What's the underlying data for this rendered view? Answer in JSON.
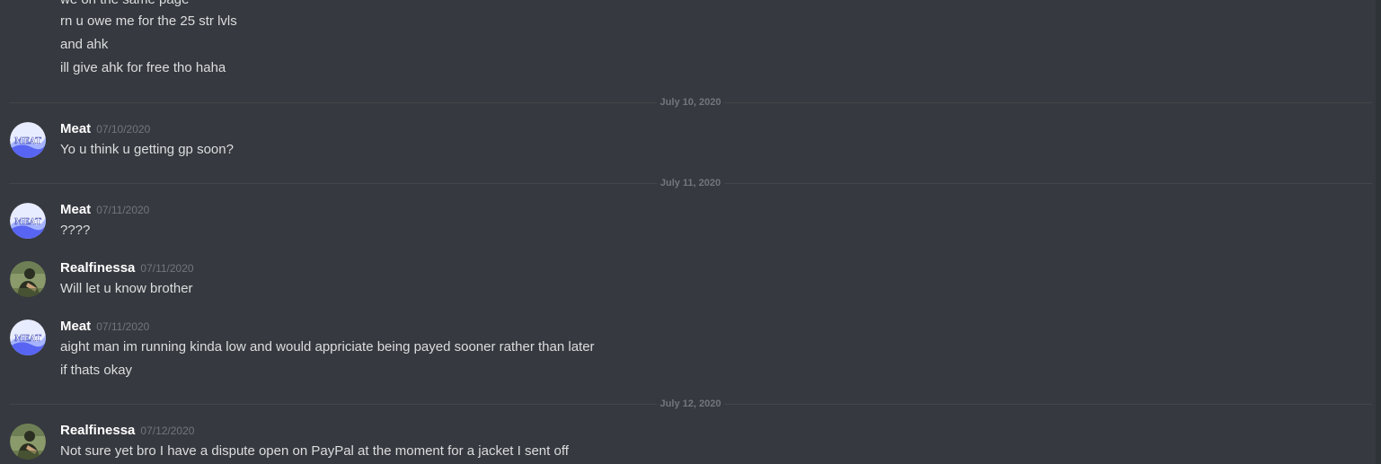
{
  "continuation": [
    "we on the same page",
    "rn u owe me for the 25 str lvls",
    "and ahk",
    "ill give ahk for free tho haha"
  ],
  "dividers": [
    "July 10, 2020",
    "July 11, 2020",
    "July 12, 2020"
  ],
  "messages": [
    {
      "author": "Meat",
      "timestamp": "07/10/2020",
      "lines": [
        "Yo u think u getting gp soon?"
      ]
    },
    {
      "author": "Meat",
      "timestamp": "07/11/2020",
      "lines": [
        "????"
      ]
    },
    {
      "author": "Realfinessa",
      "timestamp": "07/11/2020",
      "lines": [
        "Will let u know brother"
      ]
    },
    {
      "author": "Meat",
      "timestamp": "07/11/2020",
      "lines": [
        "aight man im running kinda low and would appriciate being payed sooner rather than later",
        "if thats okay"
      ]
    },
    {
      "author": "Realfinessa",
      "timestamp": "07/12/2020",
      "lines": [
        "Not sure yet bro I have a dispute open on PayPal at the moment for a jacket I sent off"
      ]
    }
  ],
  "avatars": {
    "meat_label": "MEAT",
    "meat_colors": [
      "#5865f2",
      "#a6b4ff",
      "#e8ecff"
    ],
    "realfinessa_colors": [
      "#5a6b3e",
      "#2b2f22",
      "#8a9a6a"
    ]
  },
  "colors": {
    "background": "#36393f",
    "text": "#dcddde",
    "username": "#ffffff",
    "muted": "#72767d",
    "divider": "#42454a"
  }
}
